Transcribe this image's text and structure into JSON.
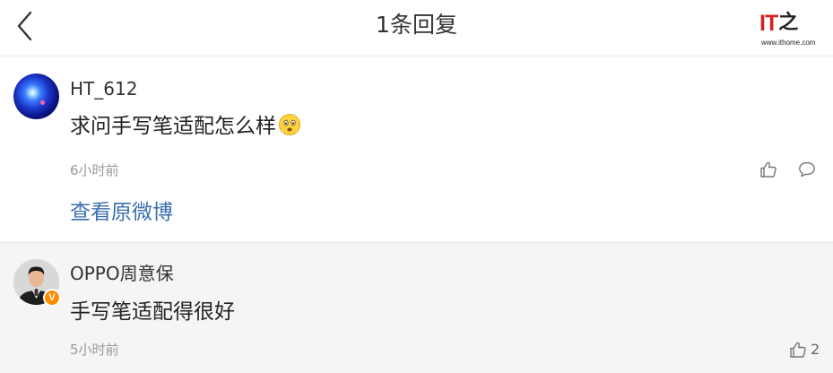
{
  "header": {
    "title": "1条回复",
    "back_icon": "chevron-left-icon"
  },
  "logo": {
    "mark_it": "IT",
    "mark_zhi": "之",
    "url": "www.ithome.com",
    "accent_color": "#d22222"
  },
  "comments": [
    {
      "username": "HT_612",
      "text": "求问手写笔适配怎么样",
      "emoji": "worried-face-emoji",
      "time": "6小时前",
      "like_icon": "thumbs-up-icon",
      "reply_icon": "comment-bubble-icon",
      "view_original": "查看原微博",
      "link_color": "#3a6fb0"
    },
    {
      "username": "OPPO周意保",
      "verified_badge": "V",
      "badge_color": "#ff8a00",
      "text": "手写笔适配得很好",
      "time": "5小时前",
      "like_icon": "thumbs-up-icon",
      "like_count": "2"
    }
  ]
}
